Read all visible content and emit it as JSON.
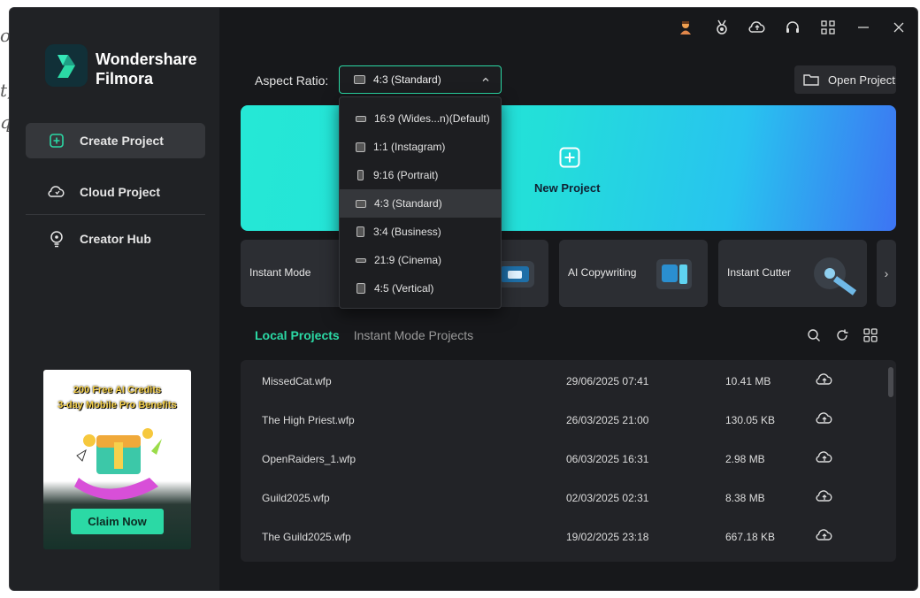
{
  "background_fragments": [
    "o",
    "t,",
    "q"
  ],
  "app": {
    "brand_line1": "Wondershare",
    "brand_line2": "Filmora"
  },
  "sidebar": {
    "items": [
      {
        "label": "Create Project",
        "icon": "plus-square-icon",
        "active": true
      },
      {
        "label": "Cloud Project",
        "icon": "cloud-icon",
        "active": false
      },
      {
        "label": "Creator Hub",
        "icon": "bulb-icon",
        "active": false
      }
    ],
    "promo": {
      "title_line1": "200 Free AI Credits",
      "title_line2": "3-day Mobile Pro Benefits",
      "button": "Claim Now"
    }
  },
  "topbar": {
    "icons": [
      "avatar-icon",
      "medal-icon",
      "cloud-upload-icon",
      "headset-icon",
      "grid-icon",
      "minimize-icon",
      "close-icon"
    ]
  },
  "aspect_ratio": {
    "label": "Aspect Ratio:",
    "selected": "4:3 (Standard)",
    "options": [
      "16:9 (Wides...n)(Default)",
      "1:1 (Instagram)",
      "9:16 (Portrait)",
      "4:3 (Standard)",
      "3:4 (Business)",
      "21:9 (Cinema)",
      "4:5 (Vertical)"
    ]
  },
  "open_project": {
    "label": "Open Project"
  },
  "hero": {
    "label": "New Project"
  },
  "tools": [
    {
      "label": "Instant Mode"
    },
    {
      "label": "AI Copywriting"
    },
    {
      "label": "Instant Cutter"
    }
  ],
  "tools_next": "›",
  "projects": {
    "tab_local": "Local Projects",
    "tab_instant": "Instant Mode Projects",
    "rows": [
      {
        "name": "MissedCat.wfp",
        "date": "29/06/2025 07:41",
        "size": "10.41 MB"
      },
      {
        "name": "The High Priest.wfp",
        "date": "26/03/2025 21:00",
        "size": "130.05 KB"
      },
      {
        "name": "OpenRaiders_1.wfp",
        "date": "06/03/2025 16:31",
        "size": "2.98 MB"
      },
      {
        "name": "Guild2025.wfp",
        "date": "02/03/2025 02:31",
        "size": "8.38 MB"
      },
      {
        "name": "The Guild2025.wfp",
        "date": "19/02/2025 23:18",
        "size": "667.18 KB"
      }
    ]
  },
  "colors": {
    "accent": "#2bd9a5",
    "window_bg": "#17181b",
    "sidebar_bg": "#202225"
  }
}
